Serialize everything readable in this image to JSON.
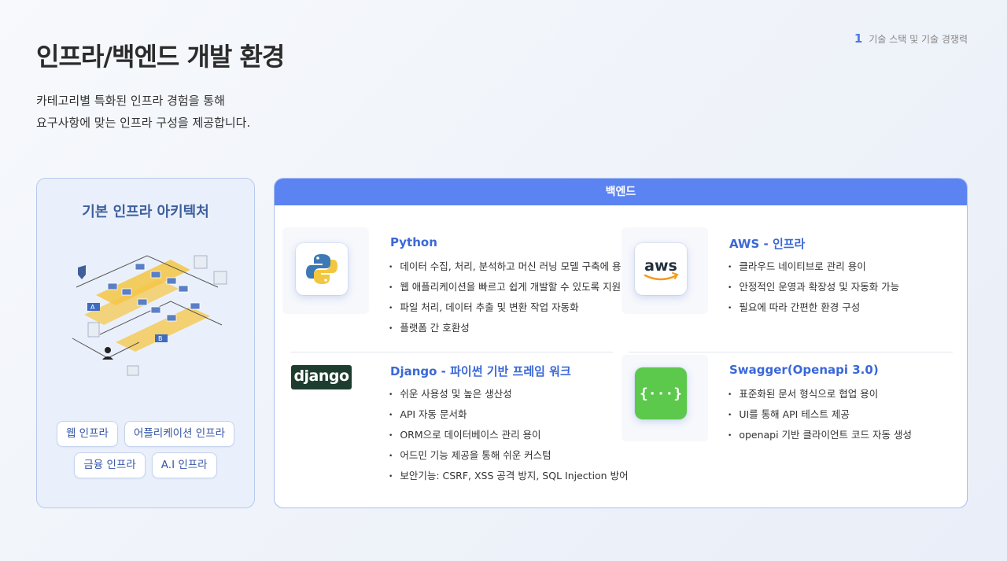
{
  "page": {
    "title": "인프라/백엔드 개발 환경",
    "subtitle_line1": "카테고리별 특화된 인프라 경험을 통해",
    "subtitle_line2": "요구사항에 맞는 인프라 구성을 제공합니다.",
    "indicator_number": "1",
    "indicator_label": "기술 스택 및 기술 경쟁력"
  },
  "left_panel": {
    "title": "기본 인프라 아키텍처",
    "tags": [
      "웹 인프라",
      "어플리케이션 인프라",
      "금융 인프라",
      "A.I 인프라"
    ]
  },
  "right_panel": {
    "header": "백엔드",
    "cards": [
      {
        "title": "Python",
        "icon": "python-logo-icon",
        "items": [
          "데이터 수집, 처리, 분석하고 머신 러닝 모델 구축에 용이",
          "웹 애플리케이션을 빠르고 쉽게 개발할 수 있도록 지원",
          "파일 처리, 데이터 추출 및 변환 작업 자동화",
          "플랫폼 간 호환성"
        ]
      },
      {
        "title": "AWS -  인프라",
        "icon": "aws-logo-icon",
        "logo_text": "aws",
        "items": [
          "클라우드 네이티브로 관리 용이",
          "안정적인 운영과 확장성 및 자동화 가능",
          "필요에 따라 간편한 환경 구성"
        ]
      },
      {
        "title": "Django - 파이썬 기반 프레임 워크",
        "icon": "django-logo-icon",
        "logo_text": "django",
        "items": [
          "쉬운 사용성 및 높은 생산성",
          "API 자동 문서화",
          "ORM으로 데이터베이스 관리 용이",
          "어드민 기능 제공을 통해 쉬운 커스텀",
          "보안기능: CSRF, XSS 공격 방지, SQL Injection 방어"
        ]
      },
      {
        "title": "Swagger(Openapi 3.0)",
        "icon": "swagger-logo-icon",
        "logo_text": "{···}",
        "items": [
          "표준화된 문서 형식으로 협업 용이",
          "UI를 통해 API 테스트 제공",
          "openapi 기반 클라이언트 코드 자동 생성"
        ]
      }
    ]
  },
  "colors": {
    "accent": "#5b83f1",
    "title_blue": "#3a68d8",
    "panel_bg": "#eaf0fb",
    "swagger_green": "#5cc84c",
    "arch_yellow": "#f5c544"
  }
}
